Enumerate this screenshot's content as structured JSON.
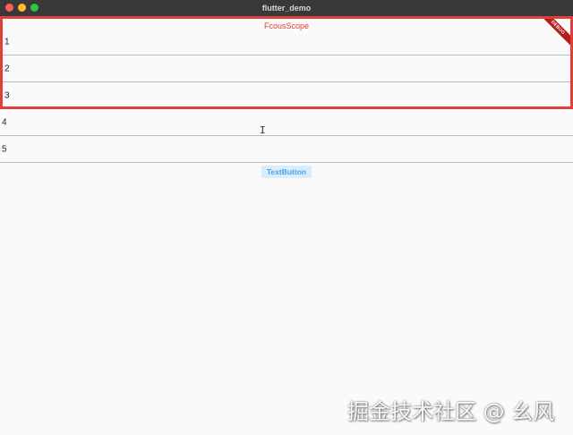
{
  "window": {
    "title": "flutter_demo"
  },
  "focus_scope": {
    "label": "FcousScope",
    "border_color": "#e0403c",
    "debug_banner": "DEBUG",
    "rows": [
      "1",
      "2",
      "3"
    ]
  },
  "outside_rows": [
    "4",
    "5"
  ],
  "text_button": {
    "label": "TextButton",
    "color": "#42a5f5"
  },
  "cursor": {
    "icon": "text-cursor-icon",
    "glyph": "I"
  },
  "watermark": {
    "text": "掘金技术社区 @ 幺风"
  }
}
